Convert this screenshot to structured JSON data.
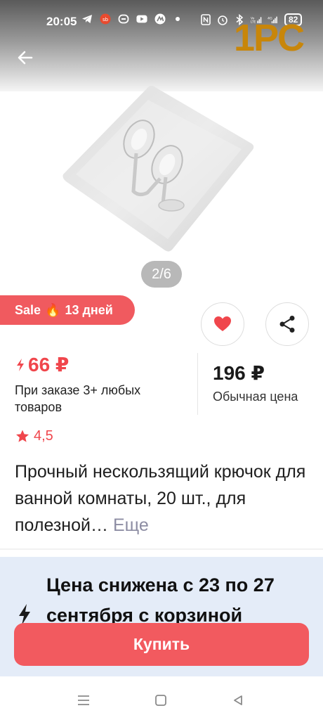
{
  "status_bar": {
    "time": "20:05",
    "battery": "82",
    "network": "4G"
  },
  "watermark": "1PC",
  "header": {
    "back_icon": "arrow-left-icon"
  },
  "gallery": {
    "pager": "2/6"
  },
  "sale": {
    "label": "Sale",
    "days": "13 дней"
  },
  "price": {
    "promo": "66 ₽",
    "promo_note": "При заказе 3+ любых товаров",
    "regular": "196 ₽",
    "regular_label": "Обычная цена"
  },
  "rating": {
    "value": "4,5"
  },
  "product": {
    "title": "Прочный нескользящий крючок для ванной комнаты, 20 шт., для полезной…",
    "more_label": "Еще"
  },
  "promo_panel": {
    "text": "Цена снижена с 23 по 27 сентября с корзиной"
  },
  "buy_button": {
    "label": "Купить"
  },
  "colors": {
    "accent": "#f25a5f",
    "price_red": "#f0464c",
    "panel_bg": "#e4ecf8"
  }
}
